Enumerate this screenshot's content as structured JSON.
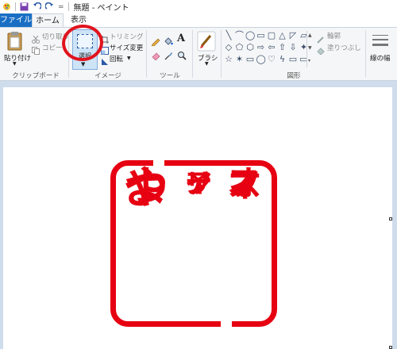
{
  "titlebar": {
    "title": "無題 - ペイント",
    "separator": "="
  },
  "tabs": {
    "file": "ファイル",
    "home": "ホーム",
    "view": "表示"
  },
  "clipboard": {
    "paste": "貼り付け",
    "cut": "切り取り",
    "copy": "コピー",
    "group": "クリップボード"
  },
  "image": {
    "select": "選択",
    "crop": "トリミング",
    "resize": "サイズ変更",
    "rotate": "回転",
    "group": "イメージ"
  },
  "tools": {
    "text_tool": "A",
    "group": "ツール"
  },
  "brushes": {
    "label": "ブラシ"
  },
  "shapes": {
    "group": "図形",
    "outline": "輪郭",
    "fill": "塗りつぶし",
    "gallery": [
      "╲",
      "⌒",
      "◯",
      "▭",
      "▢",
      "△",
      "◸",
      "▱",
      "◇",
      "⬠",
      "⬡",
      "⇨",
      "⇦",
      "⇧",
      "⇩",
      "✦",
      "☆",
      "✶",
      "▭",
      "◯",
      "♡",
      "ϟ",
      "▭",
      "▭"
    ]
  },
  "size": {
    "label": "線の幅"
  },
  "stamp": {
    "col_right": [
      "オ",
      "フ",
      "ィ",
      "ス"
    ],
    "col_middle": [
      "イ",
      "ン",
      "テ",
      "リ",
      "ア"
    ],
    "col_left": [
      "よ",
      "つ",
      "や"
    ]
  },
  "colors": {
    "stamp_red": "#e60012",
    "annotation_red": "#e0141e",
    "file_tab_blue": "#1a6fc4"
  }
}
